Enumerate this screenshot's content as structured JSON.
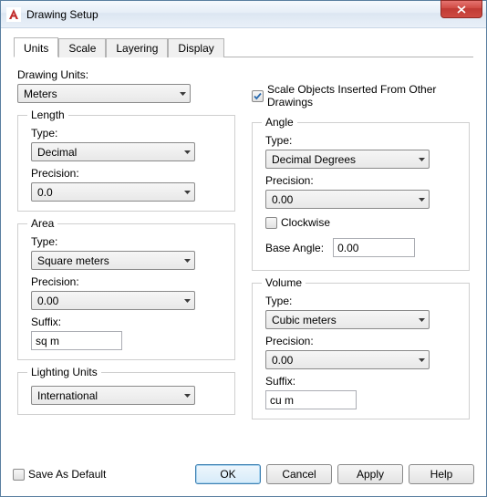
{
  "window": {
    "title": "Drawing Setup"
  },
  "tabs": [
    "Units",
    "Scale",
    "Layering",
    "Display"
  ],
  "active_tab": 0,
  "drawing_units": {
    "label": "Drawing Units:",
    "value": "Meters"
  },
  "scale_insert": {
    "checked": true,
    "label": "Scale Objects Inserted From Other Drawings"
  },
  "length": {
    "legend": "Length",
    "type_label": "Type:",
    "type_value": "Decimal",
    "precision_label": "Precision:",
    "precision_value": "0.0"
  },
  "area": {
    "legend": "Area",
    "type_label": "Type:",
    "type_value": "Square meters",
    "precision_label": "Precision:",
    "precision_value": "0.00",
    "suffix_label": "Suffix:",
    "suffix_value": "sq m"
  },
  "lighting": {
    "legend": "Lighting Units",
    "value": "International"
  },
  "angle": {
    "legend": "Angle",
    "type_label": "Type:",
    "type_value": "Decimal Degrees",
    "precision_label": "Precision:",
    "precision_value": "0.00",
    "clockwise_label": "Clockwise",
    "clockwise_checked": false,
    "base_label": "Base Angle:",
    "base_value": "0.00"
  },
  "volume": {
    "legend": "Volume",
    "type_label": "Type:",
    "type_value": "Cubic meters",
    "precision_label": "Precision:",
    "precision_value": "0.00",
    "suffix_label": "Suffix:",
    "suffix_value": "cu m"
  },
  "footer": {
    "save_default": "Save As Default",
    "ok": "OK",
    "cancel": "Cancel",
    "apply": "Apply",
    "help": "Help"
  }
}
